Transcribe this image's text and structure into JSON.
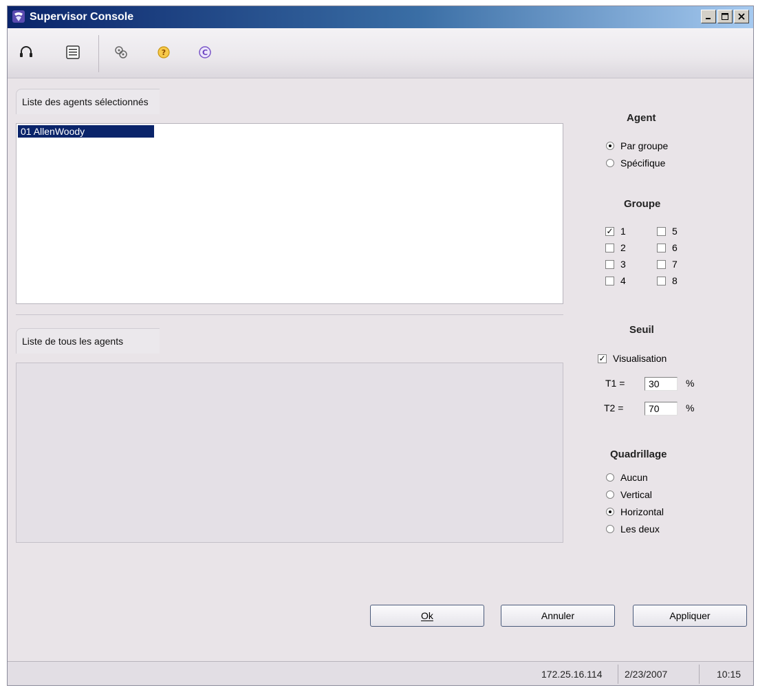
{
  "window": {
    "title": "Supervisor Console"
  },
  "toolbar": {
    "buttons": [
      {
        "icon": "headset-icon"
      },
      {
        "icon": "list-icon"
      },
      {
        "icon": "settings-icon"
      },
      {
        "icon": "help-icon"
      },
      {
        "icon": "copyright-icon"
      }
    ]
  },
  "selected_agents": {
    "label": "Liste des agents sélectionnés",
    "items": [
      "01  AllenWoody"
    ]
  },
  "all_agents": {
    "label": "Liste de tous les agents"
  },
  "agent": {
    "title": "Agent",
    "options": [
      {
        "label": "Par groupe",
        "checked": true
      },
      {
        "label": "Spécifique",
        "checked": false
      }
    ]
  },
  "groupe": {
    "title": "Groupe",
    "items": [
      {
        "label": "1",
        "checked": true
      },
      {
        "label": "2",
        "checked": false
      },
      {
        "label": "3",
        "checked": false
      },
      {
        "label": "4",
        "checked": false
      },
      {
        "label": "5",
        "checked": false
      },
      {
        "label": "6",
        "checked": false
      },
      {
        "label": "7",
        "checked": false
      },
      {
        "label": "8",
        "checked": false
      }
    ]
  },
  "seuil": {
    "title": "Seuil",
    "visualisation_label": "Visualisation",
    "visualisation_checked": true,
    "t1_label": "T1 =",
    "t1_value": "30",
    "t2_label": "T2 =",
    "t2_value": "70",
    "unit": "%"
  },
  "quadrillage": {
    "title": "Quadrillage",
    "options": [
      {
        "label": "Aucun",
        "checked": false
      },
      {
        "label": "Vertical",
        "checked": false
      },
      {
        "label": "Horizontal",
        "checked": true
      },
      {
        "label": "Les deux",
        "checked": false
      }
    ]
  },
  "buttons": {
    "ok": "Ok",
    "annuler": "Annuler",
    "appliquer": "Appliquer"
  },
  "status": {
    "ip": "172.25.16.114",
    "date": "2/23/2007",
    "time": "10:15"
  }
}
